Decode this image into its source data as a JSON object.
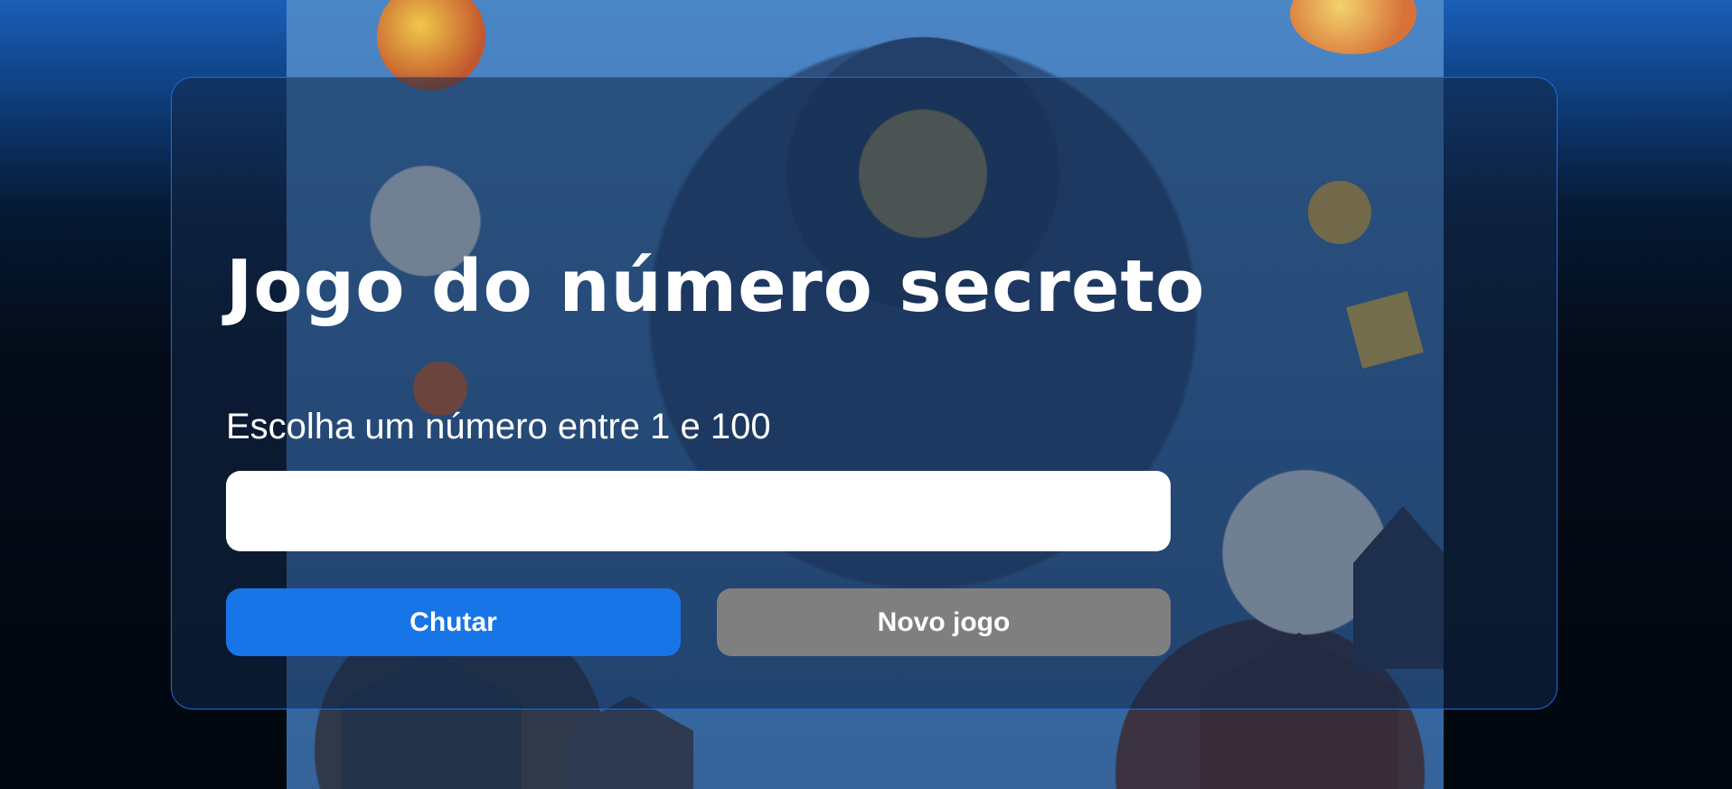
{
  "game": {
    "title": "Jogo do número secreto",
    "prompt": "Escolha um número entre 1 e 100",
    "input": {
      "value": "",
      "placeholder": ""
    },
    "buttons": {
      "guess_label": "Chutar",
      "new_game_label": "Novo jogo"
    }
  },
  "colors": {
    "primary_button": "#1875e8",
    "secondary_button": "#7f7f7f",
    "card_border": "#1b6ee0",
    "text": "#ffffff"
  },
  "background": {
    "illustration": "number-spiral-illustration"
  }
}
